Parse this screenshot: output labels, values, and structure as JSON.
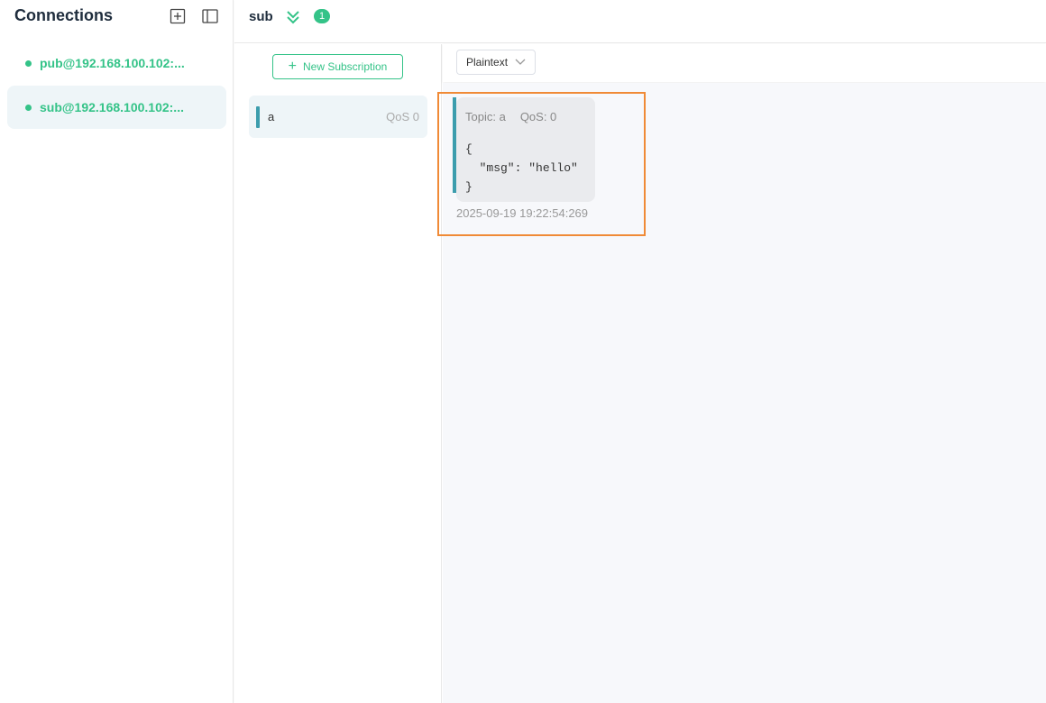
{
  "sidebar": {
    "title": "Connections",
    "connections": [
      {
        "label": "pub@192.168.100.102:...",
        "status": "connected"
      },
      {
        "label": "sub@192.168.100.102:...",
        "status": "connected",
        "active": true
      }
    ]
  },
  "header": {
    "title": "sub",
    "badge": "1"
  },
  "subscriptions": {
    "new_button_label": "New Subscription",
    "items": [
      {
        "topic": "a",
        "qos": "QoS 0",
        "color": "#3c9dad"
      }
    ]
  },
  "toolbar": {
    "format": "Plaintext"
  },
  "messages": [
    {
      "topic": "Topic: a",
      "qos": "QoS: 0",
      "payload": "{\n  \"msg\": \"hello\"\n}",
      "time": "2025-09-19 19:22:54:269"
    }
  ],
  "colors": {
    "accent": "#34c388",
    "topic_color": "#3c9dad",
    "highlight": "#f08a36"
  }
}
